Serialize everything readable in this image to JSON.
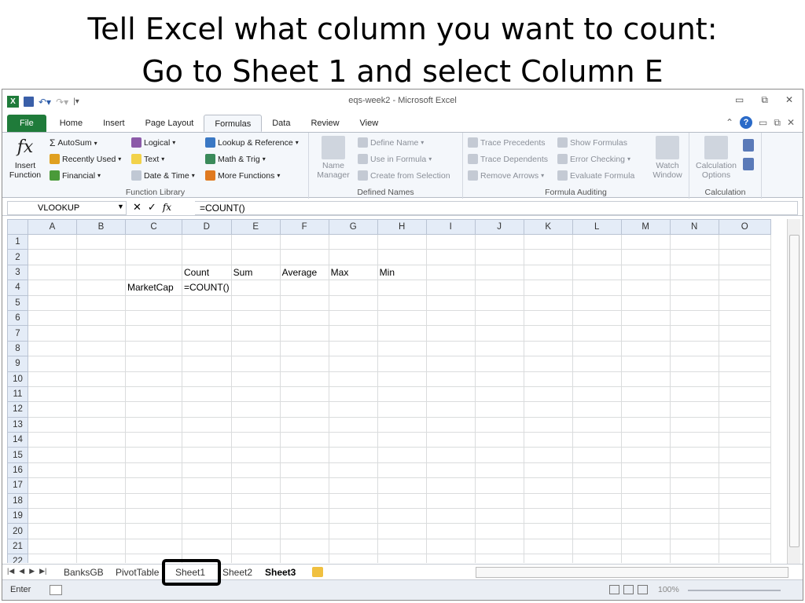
{
  "slide": {
    "line1": "Tell Excel what column you want to count:",
    "line2": "Go to Sheet 1 and select Column E"
  },
  "window": {
    "title": "eqs-week2 - Microsoft Excel",
    "min": "▭",
    "restore": "⧉",
    "close": "✕"
  },
  "tabs": [
    "File",
    "Home",
    "Insert",
    "Page Layout",
    "Formulas",
    "Data",
    "Review",
    "View"
  ],
  "ribbon": {
    "insert_function": "Insert\nFunction",
    "autosum": "AutoSum",
    "recently_used": "Recently Used",
    "financial": "Financial",
    "logical": "Logical",
    "text": "Text",
    "date_time": "Date & Time",
    "lookup": "Lookup & Reference",
    "math_trig": "Math & Trig",
    "more_functions": "More Functions",
    "function_library": "Function Library",
    "name_manager": "Name\nManager",
    "define_name": "Define Name",
    "use_in_formula": "Use in Formula",
    "create_from_selection": "Create from Selection",
    "defined_names": "Defined Names",
    "trace_precedents": "Trace Precedents",
    "trace_dependents": "Trace Dependents",
    "remove_arrows": "Remove Arrows",
    "show_formulas": "Show Formulas",
    "error_checking": "Error Checking",
    "evaluate_formula": "Evaluate Formula",
    "watch_window": "Watch\nWindow",
    "formula_auditing": "Formula Auditing",
    "calculation_options": "Calculation\nOptions",
    "calculation": "Calculation"
  },
  "formula_bar": {
    "name_box": "VLOOKUP",
    "cancel": "✕",
    "enter": "✓",
    "fx": "fx",
    "formula": "=COUNT()"
  },
  "columns": [
    "A",
    "B",
    "C",
    "D",
    "E",
    "F",
    "G",
    "H",
    "I",
    "J",
    "K",
    "L",
    "M",
    "N",
    "O"
  ],
  "rows": [
    "1",
    "2",
    "3",
    "4",
    "5",
    "6",
    "7",
    "8",
    "9",
    "10",
    "11",
    "12",
    "13",
    "14",
    "15",
    "16",
    "17",
    "18",
    "19",
    "20",
    "21",
    "22"
  ],
  "cells": {
    "D3": "Count",
    "E3": "Sum",
    "F3": "Average",
    "G3": "Max",
    "H3": "Min",
    "C4": "MarketCap",
    "D4": "=COUNT()"
  },
  "sheet_tabs": [
    "BanksGB",
    "PivotTable",
    "Sheet1",
    "Sheet2",
    "Sheet3"
  ],
  "active_sheet": "Sheet3",
  "status": {
    "mode": "Enter",
    "zoom": "100%"
  }
}
